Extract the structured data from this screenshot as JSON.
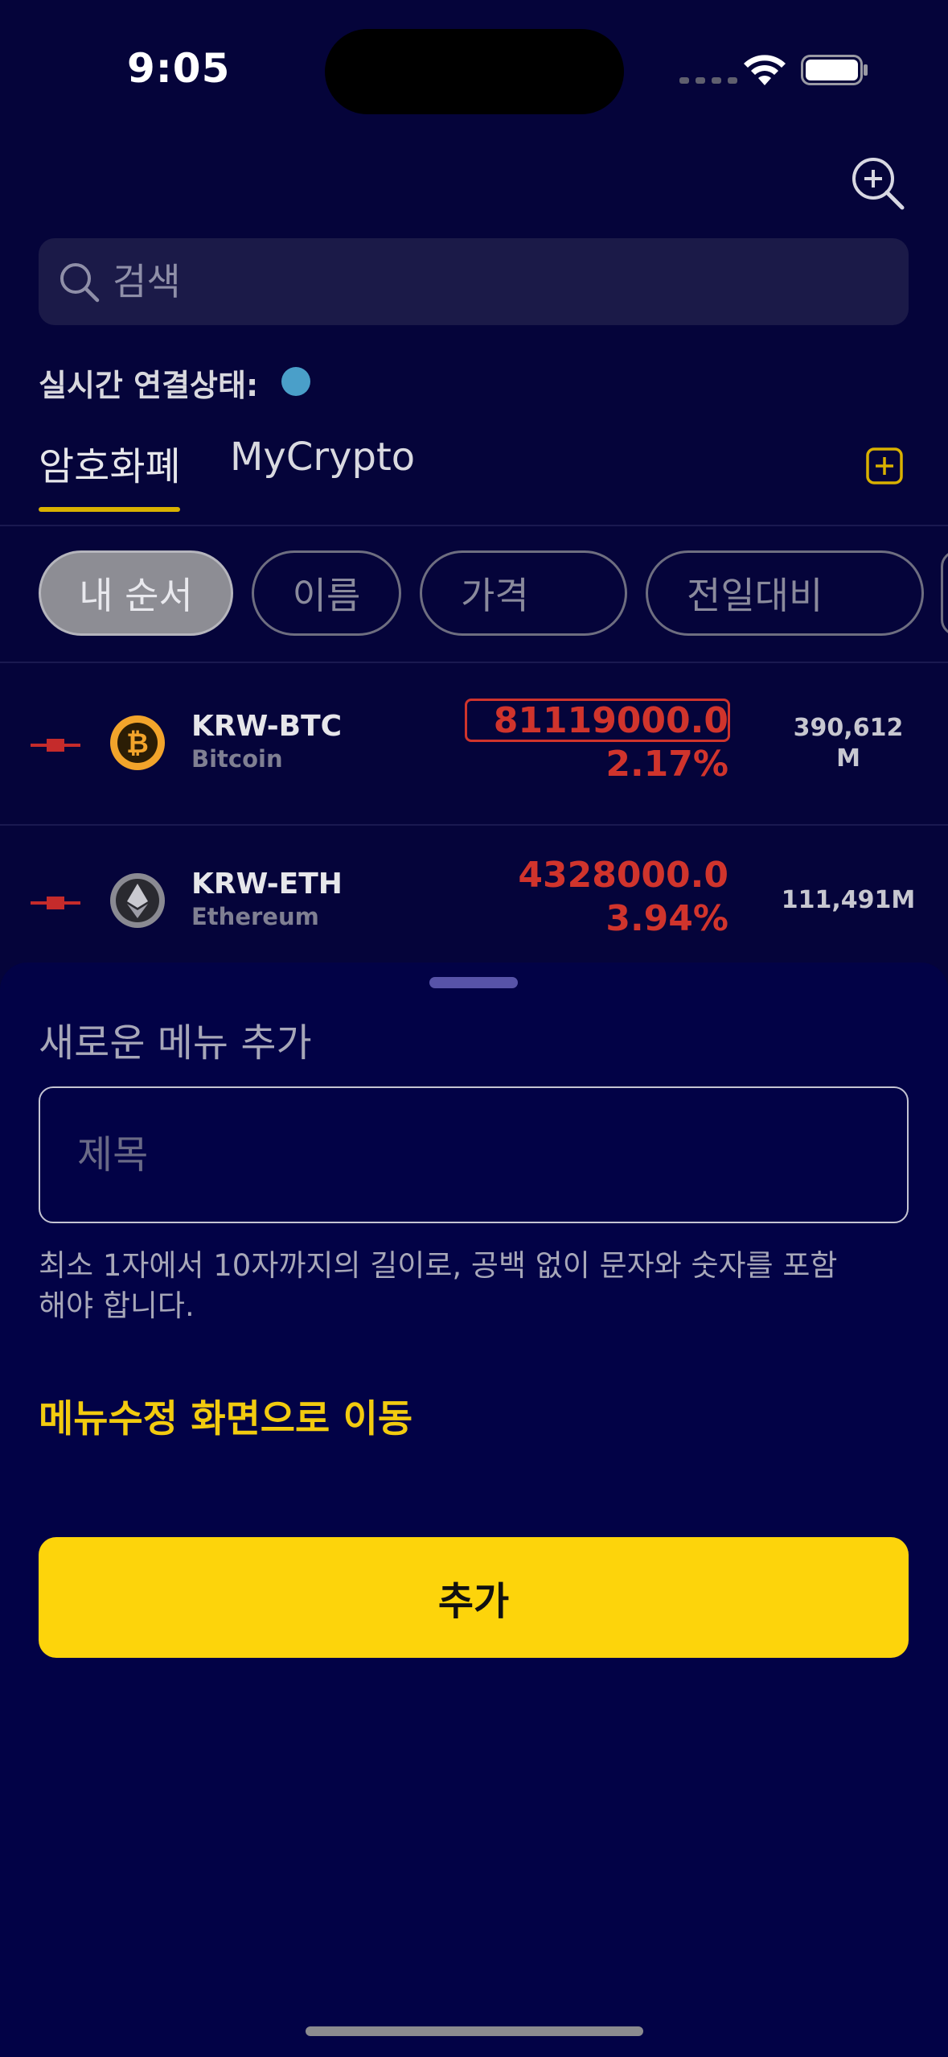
{
  "status_bar": {
    "time": "9:05"
  },
  "search": {
    "placeholder": "검색"
  },
  "connection": {
    "label": "실시간 연결상태:",
    "status_color": "#4a9fc9"
  },
  "tabs": [
    {
      "label": "암호화폐",
      "active": true
    },
    {
      "label": "MyCrypto",
      "active": false
    }
  ],
  "sort_chips": [
    {
      "label": "내 순서",
      "active": true
    },
    {
      "label": "이름",
      "active": false
    },
    {
      "label": "가격",
      "active": false
    },
    {
      "label": "전일대비",
      "active": false
    }
  ],
  "coins": [
    {
      "symbol": "KRW-BTC",
      "name": "Bitcoin",
      "price": "81119000.0",
      "change": "2.17%",
      "volume": "390,612\nM",
      "logo": "bitcoin-logo-icon"
    },
    {
      "symbol": "KRW-ETH",
      "name": "Ethereum",
      "price": "4328000.0",
      "change": "3.94%",
      "volume": "111,491M",
      "logo": "ethereum-logo-icon"
    }
  ],
  "sheet": {
    "title": "새로운 메뉴 추가",
    "input_placeholder": "제목",
    "hint": "최소 1자에서 10자까지의 길이로, 공백 없이 문자와 숫자를 포함해야 합니다.",
    "edit_link": "메뉴수정 화면으로 이동",
    "add_button": "추가"
  },
  "colors": {
    "background": "#05043a",
    "accent_yellow": "#fdd40b",
    "price_red": "#d0342c"
  }
}
